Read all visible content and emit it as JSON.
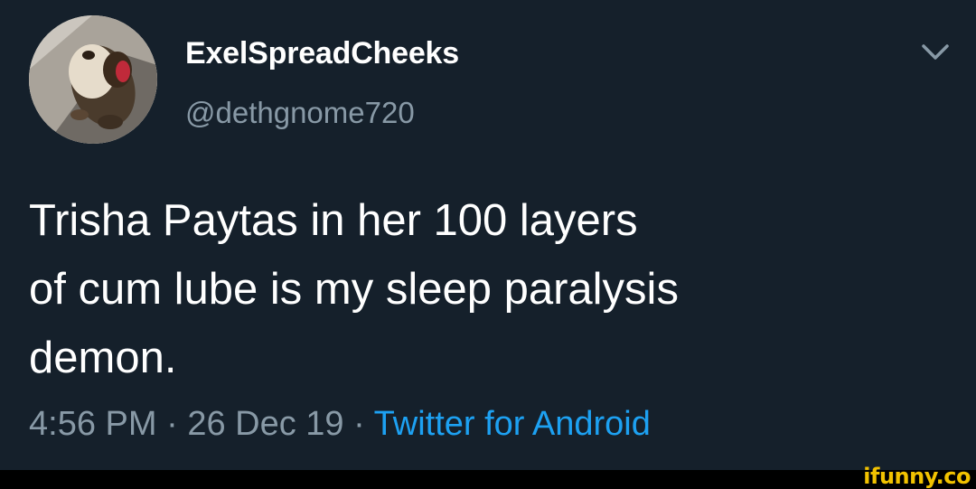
{
  "tweet": {
    "display_name": "ExelSpreadCheeks",
    "handle": "@dethgnome720",
    "text_lines": [
      "Trisha Paytas in her 100 layers",
      "of cum lube is my sleep paralysis",
      "demon."
    ],
    "time": "4:56 PM",
    "separator": " · ",
    "date": "26 Dec 19",
    "source": "Twitter for Android",
    "menu_icon": "chevron-down-icon",
    "avatar_icon": "ferret-avatar"
  },
  "watermark": "ifunny.co",
  "colors": {
    "background": "#15202b",
    "primary_text": "#ffffff",
    "secondary_text": "#8899a6",
    "link": "#1da1f2",
    "watermark": "#f2c200"
  }
}
